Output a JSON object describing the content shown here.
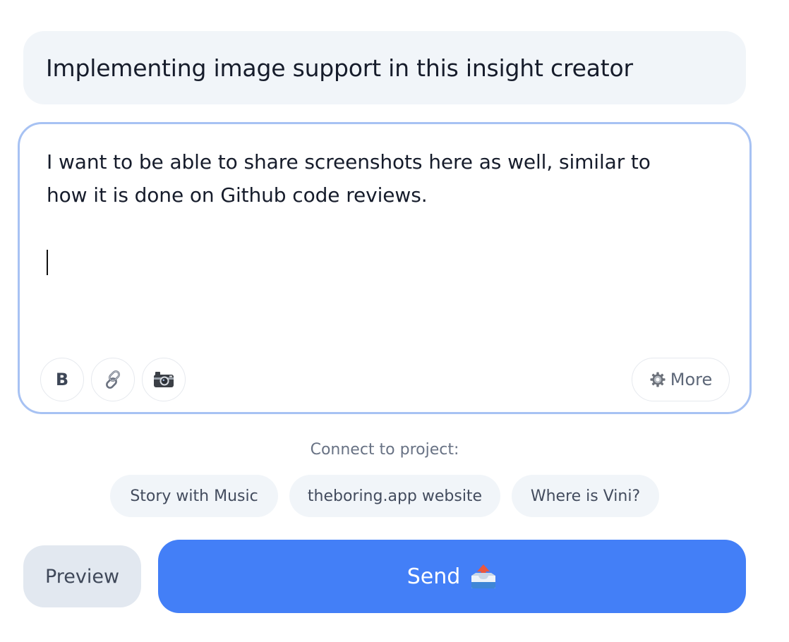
{
  "title": {
    "value": "Implementing image support in this insight creator"
  },
  "editor": {
    "lines": [
      "I want to be able to share screenshots here as well, similar to",
      "how it is done on Github code reviews."
    ],
    "toolbar": {
      "bold_label": "B",
      "link_icon": "link-icon",
      "camera_icon": "camera-icon",
      "more_icon": "gear-icon",
      "more_label": "More"
    }
  },
  "connect": {
    "label": "Connect to project:",
    "projects": [
      "Story with Music",
      "theboring.app website",
      "Where is Vini?"
    ]
  },
  "actions": {
    "preview_label": "Preview",
    "send_label": "Send",
    "send_icon": "outbox-tray-icon"
  },
  "colors": {
    "accent": "#437ff7",
    "editor_border": "#a7c2f3",
    "field_bg": "#f1f5f9",
    "preview_bg": "#e2e8f0"
  }
}
